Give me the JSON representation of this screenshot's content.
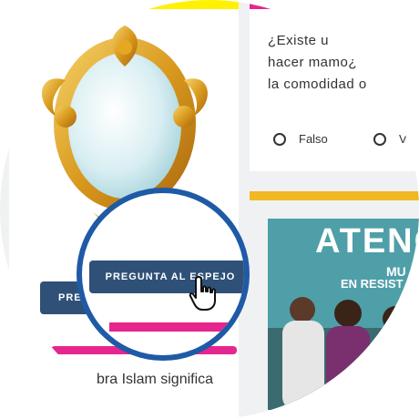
{
  "left_card": {
    "button_label_partial": "PRE",
    "bottom_text": "bra Islam significa"
  },
  "magnifier": {
    "button_label": "PREGUNTA AL ESPEJO"
  },
  "quiz_card": {
    "question_lines": [
      "¿Existe u",
      "hacer mamo¿",
      "la comodidad o"
    ],
    "options": [
      "Falso",
      "V"
    ]
  },
  "news_card": {
    "title": "ATENC",
    "subtitle_1": "MU",
    "subtitle_2": "EN RESIST"
  },
  "colors": {
    "button": "#2f5178",
    "pink_accent": "#e6268f",
    "yellow_accent": "#f0b823",
    "lens_ring": "#1f5aa6"
  },
  "icons": [
    "mirror-illustration",
    "hand-pointer-icon"
  ]
}
